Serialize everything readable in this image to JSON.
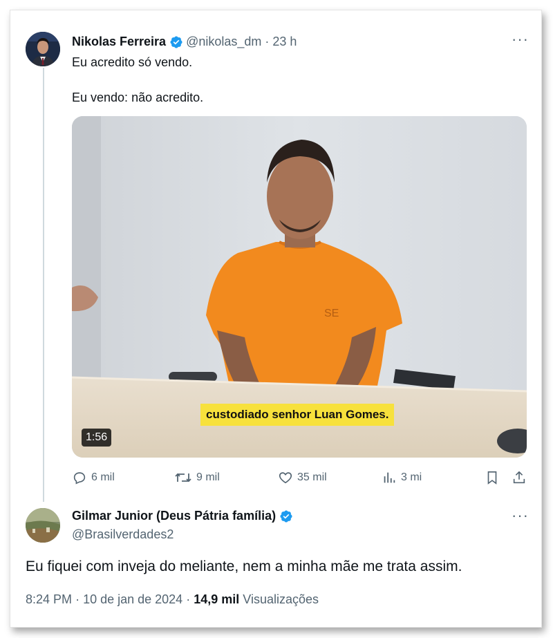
{
  "tweet": {
    "author_name": "Nikolas Ferreira",
    "handle": "@nikolas_dm",
    "time": "23 h",
    "text_line1": "Eu acredito só vendo.",
    "text_line2": "Eu vendo: não acredito.",
    "video": {
      "caption": "custodiado senhor Luan Gomes.",
      "duration": "1:56",
      "shirt_mark": "SE"
    },
    "stats": {
      "replies": "6 mil",
      "reposts": "9 mil",
      "likes": "35 mil",
      "views": "3 mi"
    }
  },
  "reply": {
    "author_name": "Gilmar Junior (Deus Pátria família)",
    "handle": "@Brasilverdades2",
    "text": "Eu fiquei com inveja do meliante, nem a minha mãe me trata assim.",
    "time": "8:24 PM",
    "date": "10 de jan de 2024",
    "views_count": "14,9 mil",
    "views_label": "Visualizações"
  },
  "colors": {
    "verified": "#1d9bf0",
    "muted": "#536471",
    "text": "#0f1419",
    "caption_bg": "#f7e13c"
  }
}
